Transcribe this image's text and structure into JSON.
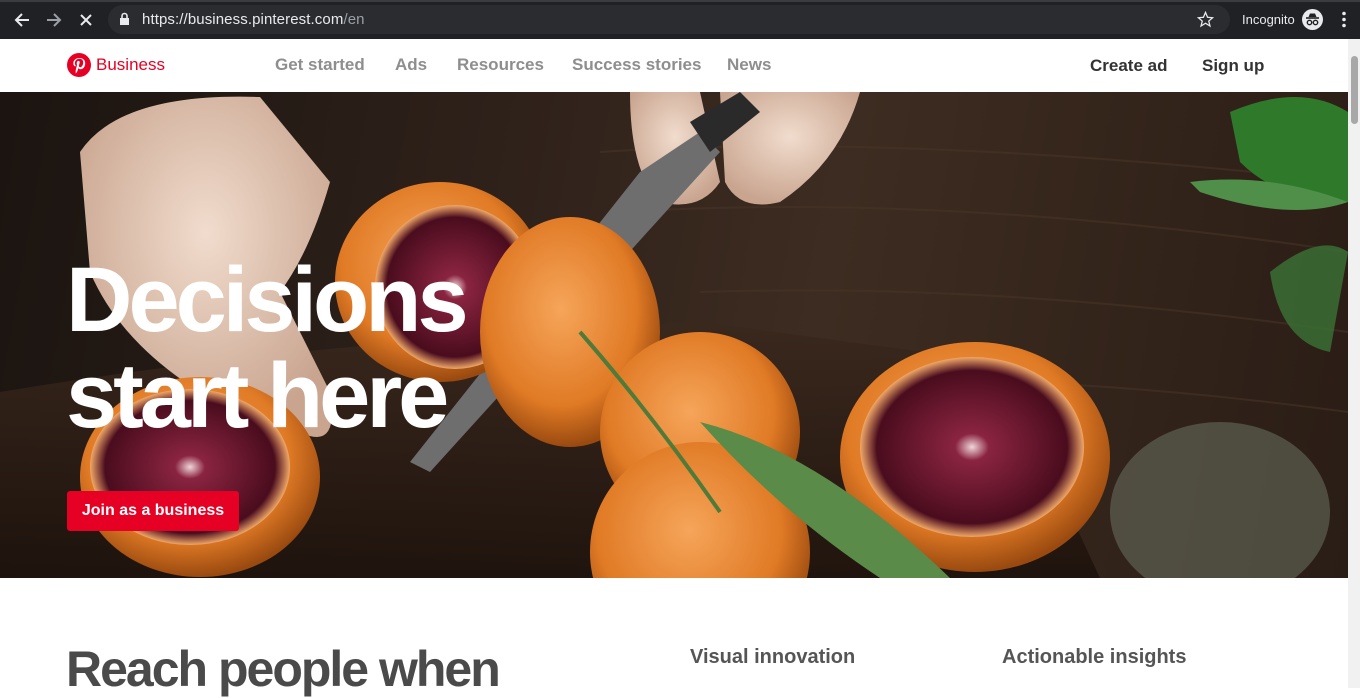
{
  "browser": {
    "url_host": "https://business.pinterest.com",
    "url_path": "/en",
    "incognito_label": "Incognito"
  },
  "header": {
    "logo_text": "Business",
    "nav": [
      "Get started",
      "Ads",
      "Resources",
      "Success stories",
      "News"
    ],
    "create_ad": "Create ad",
    "sign_up": "Sign up"
  },
  "hero": {
    "title_line1": "Decisions",
    "title_line2": "start here",
    "cta": "Join as a business"
  },
  "below": {
    "heading": "Reach people when",
    "feature1": "Visual innovation",
    "feature2": "Actionable insights"
  },
  "colors": {
    "brand": "#e60023",
    "chrome": "#202124"
  },
  "icons": [
    "back-arrow-icon",
    "forward-arrow-icon",
    "stop-icon",
    "lock-icon",
    "star-icon",
    "incognito-icon",
    "menu-dots-icon",
    "pinterest-logo-icon"
  ]
}
